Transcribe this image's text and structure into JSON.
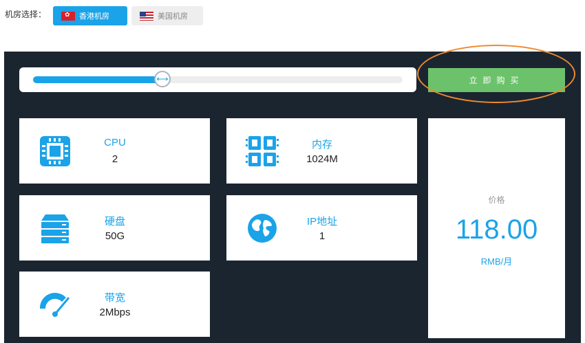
{
  "region": {
    "label": "机房选择：",
    "options": [
      {
        "name": "香港机房",
        "active": true
      },
      {
        "name": "美国机房",
        "active": false
      }
    ]
  },
  "slider": {
    "value_fraction": 0.35
  },
  "buy_button": {
    "label": "立即购买"
  },
  "specs": [
    {
      "title": "CPU",
      "value": "2",
      "icon": "cpu-icon"
    },
    {
      "title": "内存",
      "value": "1024M",
      "icon": "memory-icon"
    },
    {
      "title": "硬盘",
      "value": "50G",
      "icon": "disk-icon"
    },
    {
      "title": "IP地址",
      "value": "1",
      "icon": "globe-icon"
    },
    {
      "title": "带宽",
      "value": "2Mbps",
      "icon": "speedometer-icon"
    }
  ],
  "price": {
    "label": "价格",
    "value": "118.00",
    "unit": "RMB/月"
  },
  "colors": {
    "accent": "#1aa3e8",
    "panel": "#1b2530",
    "buy": "#6cc26a",
    "highlight": "#f08a2c"
  }
}
